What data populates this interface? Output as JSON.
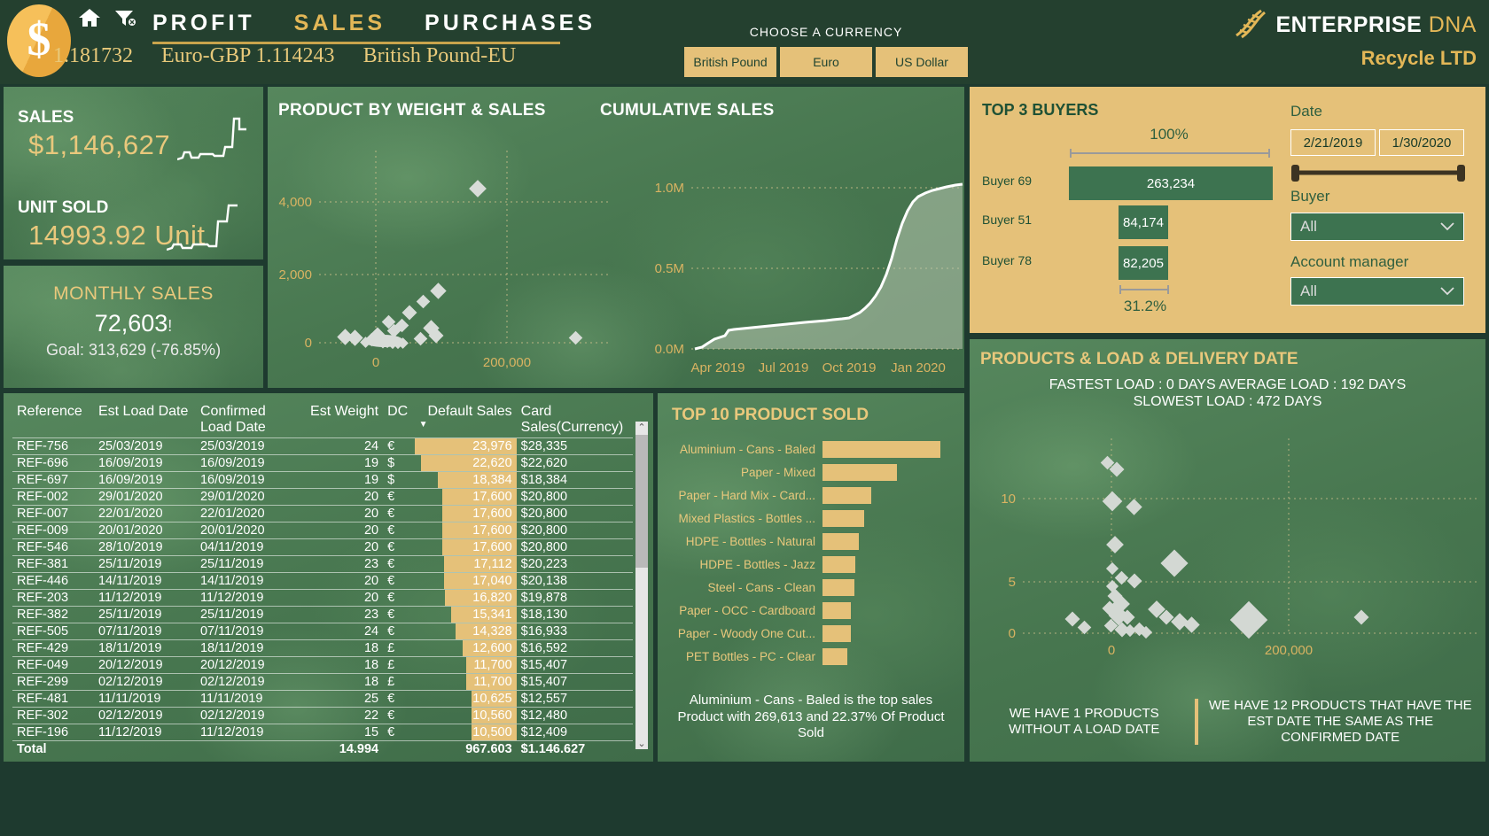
{
  "header": {
    "coin_glyph": "$",
    "nav": [
      {
        "label": "PROFIT",
        "active": false
      },
      {
        "label": "SALES",
        "active": true
      },
      {
        "label": "PURCHASES",
        "active": false
      }
    ],
    "rates": [
      "1.181732",
      "Euro-GBP 1.114243",
      "British Pound-EU"
    ],
    "currency_title": "CHOOSE A CURRENCY",
    "currency_options": [
      "British Pound",
      "Euro",
      "US Dollar"
    ],
    "logo_main": "ENTERPRISE",
    "logo_dna": "DNA",
    "logo_sub": "Recycle LTD"
  },
  "kpi": {
    "sales_label": "SALES",
    "sales_value": "$1,146,627",
    "unit_label": "UNIT SOLD",
    "unit_value": "14993.92 Unit",
    "monthly_title": "MONTHLY SALES",
    "monthly_value": "72,603",
    "monthly_flag": "!",
    "monthly_goal": "Goal: 313,629 (-76.85%)"
  },
  "charts": {
    "scatter_title": "PRODUCT BY WEIGHT & SALES",
    "cumulative_title": "CUMULATIVE SALES"
  },
  "buyers": {
    "title": "TOP 3 BUYERS",
    "top_pct": "100%",
    "bottom_pct": "31.2%",
    "rows": [
      {
        "name": "Buyer 69",
        "value": "263,234",
        "pct": 100
      },
      {
        "name": "Buyer 51",
        "value": "84,174",
        "pct": 32
      },
      {
        "name": "Buyer 78",
        "value": "82,205",
        "pct": 31.2
      }
    ],
    "date_label": "Date",
    "date_from": "2/21/2019",
    "date_to": "1/30/2020",
    "buyer_label": "Buyer",
    "buyer_value": "All",
    "am_label": "Account manager",
    "am_value": "All"
  },
  "table": {
    "columns": [
      "Reference",
      "Est Load Date",
      "Confirmed Load Date",
      "Est Weight",
      "DC",
      "Default Sales",
      "Card Sales(Currency)"
    ],
    "rows": [
      [
        "REF-756",
        "25/03/2019",
        "25/03/2019",
        "24",
        "€",
        "23,976",
        "$28,335"
      ],
      [
        "REF-696",
        "16/09/2019",
        "16/09/2019",
        "19",
        "$",
        "22,620",
        "$22,620"
      ],
      [
        "REF-697",
        "16/09/2019",
        "16/09/2019",
        "19",
        "$",
        "18,384",
        "$18,384"
      ],
      [
        "REF-002",
        "29/01/2020",
        "29/01/2020",
        "20",
        "€",
        "17,600",
        "$20,800"
      ],
      [
        "REF-007",
        "22/01/2020",
        "22/01/2020",
        "20",
        "€",
        "17,600",
        "$20,800"
      ],
      [
        "REF-009",
        "20/01/2020",
        "20/01/2020",
        "20",
        "€",
        "17,600",
        "$20,800"
      ],
      [
        "REF-546",
        "28/10/2019",
        "04/11/2019",
        "20",
        "€",
        "17,600",
        "$20,800"
      ],
      [
        "REF-381",
        "25/11/2019",
        "25/11/2019",
        "23",
        "€",
        "17,112",
        "$20,223"
      ],
      [
        "REF-446",
        "14/11/2019",
        "14/11/2019",
        "20",
        "€",
        "17,040",
        "$20,138"
      ],
      [
        "REF-203",
        "11/12/2019",
        "11/12/2019",
        "20",
        "€",
        "16,820",
        "$19,878"
      ],
      [
        "REF-382",
        "25/11/2019",
        "25/11/2019",
        "23",
        "€",
        "15,341",
        "$18,130"
      ],
      [
        "REF-505",
        "07/11/2019",
        "07/11/2019",
        "24",
        "€",
        "14,328",
        "$16,933"
      ],
      [
        "REF-429",
        "18/11/2019",
        "18/11/2019",
        "18",
        "£",
        "12,600",
        "$16,592"
      ],
      [
        "REF-049",
        "20/12/2019",
        "20/12/2019",
        "18",
        "£",
        "11,700",
        "$15,407"
      ],
      [
        "REF-299",
        "02/12/2019",
        "02/12/2019",
        "18",
        "£",
        "11,700",
        "$15,407"
      ],
      [
        "REF-481",
        "11/11/2019",
        "11/11/2019",
        "25",
        "€",
        "10,625",
        "$12,557"
      ],
      [
        "REF-302",
        "02/12/2019",
        "02/12/2019",
        "22",
        "€",
        "10,560",
        "$12,480"
      ],
      [
        "REF-196",
        "11/12/2019",
        "11/12/2019",
        "15",
        "€",
        "10,500",
        "$12,409"
      ]
    ],
    "total": [
      "Total",
      "",
      "",
      "14,994",
      "",
      "967,603",
      "$1,146,627"
    ]
  },
  "top10": {
    "title": "TOP 10 PRODUCT SOLD",
    "caption": "Aluminium - Cans - Baled is the top sales Product with 269,613 and 22.37% Of Product Sold",
    "items": [
      {
        "name": "Aluminium - Cans - Baled",
        "pct": 100
      },
      {
        "name": "Paper - Mixed",
        "pct": 63
      },
      {
        "name": "Paper - Hard Mix - Card...",
        "pct": 41
      },
      {
        "name": "Mixed Plastics - Bottles ...",
        "pct": 35
      },
      {
        "name": "HDPE - Bottles - Natural",
        "pct": 31
      },
      {
        "name": "HDPE - Bottles - Jazz",
        "pct": 28
      },
      {
        "name": "Steel - Cans - Clean",
        "pct": 27
      },
      {
        "name": "Paper - OCC - Cardboard",
        "pct": 24
      },
      {
        "name": "Paper - Woody One Cut...",
        "pct": 24
      },
      {
        "name": "PET Bottles - PC - Clear",
        "pct": 21
      }
    ]
  },
  "loaddate": {
    "title": "PRODUCTS & LOAD & DELIVERY DATE",
    "sub_line1": "FASTEST LOAD : 0 DAYS AVERAGE LOAD : 192 DAYS",
    "sub_line2": "SLOWEST LOAD : 472 DAYS",
    "foot_left": "WE HAVE 1 PRODUCTS WITHOUT A LOAD DATE",
    "foot_right": "WE HAVE 12 PRODUCTS THAT HAVE THE EST DATE THE SAME AS THE CONFIRMED DATE"
  },
  "chart_data": [
    {
      "type": "scatter",
      "title": "PRODUCT BY WEIGHT & SALES",
      "xlabel": "",
      "ylabel": "",
      "xticks": [
        0,
        200000
      ],
      "yticks": [
        0,
        2000,
        4000
      ],
      "xlim": [
        -60000,
        330000
      ],
      "ylim": [
        0,
        4800
      ],
      "grid": true,
      "points": [
        [
          150000,
          4250
        ],
        [
          300000,
          320
        ],
        [
          -40000,
          330
        ],
        [
          -32000,
          330
        ],
        [
          8000,
          700
        ],
        [
          8000,
          420
        ],
        [
          22000,
          730
        ],
        [
          30000,
          530
        ],
        [
          63000,
          1180
        ],
        [
          80000,
          1480
        ],
        [
          95000,
          1650
        ],
        [
          72000,
          480
        ],
        [
          78000,
          560
        ],
        [
          85000,
          330
        ],
        [
          88000,
          250
        ],
        [
          55000,
          230
        ],
        [
          40000,
          180
        ],
        [
          2000,
          150
        ],
        [
          6000,
          120
        ],
        [
          10000,
          100
        ],
        [
          14000,
          90
        ],
        [
          18000,
          120
        ],
        [
          22000,
          150
        ],
        [
          26000,
          110
        ],
        [
          4000,
          60
        ],
        [
          12000,
          55
        ],
        [
          20000,
          50
        ]
      ]
    },
    {
      "type": "area",
      "title": "CUMULATIVE SALES",
      "xticks": [
        "Apr 2019",
        "Jul 2019",
        "Oct 2019",
        "Jan 2020"
      ],
      "yticks": [
        "0.0M",
        "0.5M",
        "1.0M"
      ],
      "ylim": [
        0,
        1150000
      ],
      "grid": true,
      "series": [
        {
          "name": "Cumulative Sales",
          "values": [
            0,
            5000,
            18000,
            42000,
            60000,
            78000,
            82000,
            90000,
            96000,
            104000,
            112000,
            120000,
            128000,
            134000,
            140000,
            146000,
            152000,
            158000,
            164000,
            172000,
            180000,
            190000,
            205000,
            238000,
            300000,
            390000,
            500000,
            620000,
            760000,
            880000,
            960000,
            1010000,
            1060000,
            1090000,
            1110000,
            1146627
          ]
        }
      ]
    },
    {
      "type": "bar",
      "title": "TOP 3 BUYERS",
      "orientation": "horizontal",
      "categories": [
        "Buyer 69",
        "Buyer 51",
        "Buyer 78"
      ],
      "values": [
        263234,
        84174,
        82205
      ],
      "annotations": [
        "100%",
        "31.2%"
      ]
    },
    {
      "type": "bar",
      "title": "TOP 10 PRODUCT SOLD",
      "orientation": "horizontal",
      "categories": [
        "Aluminium - Cans - Baled",
        "Paper - Mixed",
        "Paper - Hard Mix - Card...",
        "Mixed Plastics - Bottles ...",
        "HDPE - Bottles - Natural",
        "HDPE - Bottles - Jazz",
        "Steel - Cans - Clean",
        "Paper - OCC - Cardboard",
        "Paper - Woody One Cut...",
        "PET Bottles - PC - Clear"
      ],
      "values": [
        269613,
        170000,
        110000,
        94000,
        84000,
        76000,
        73000,
        65000,
        65000,
        57000
      ]
    },
    {
      "type": "scatter",
      "title": "PRODUCTS & LOAD & DELIVERY DATE",
      "xticks": [
        0,
        200000
      ],
      "yticks": [
        0,
        5,
        10
      ],
      "xlim": [
        -60000,
        330000
      ],
      "ylim": [
        -1,
        15
      ],
      "grid": true,
      "points": [
        [
          -4000,
          12.6
        ],
        [
          4000,
          12.1
        ],
        [
          0,
          10.1
        ],
        [
          14000,
          9.6
        ],
        [
          2000,
          7.0
        ],
        [
          1000,
          5.4
        ],
        [
          8000,
          5.0
        ],
        [
          14000,
          4.9
        ],
        [
          70000,
          6.2
        ],
        [
          2000,
          4.0
        ],
        [
          5000,
          3.5
        ],
        [
          9000,
          3.2
        ],
        [
          38000,
          2.6
        ],
        [
          52000,
          2.1
        ],
        [
          60000,
          1.7
        ],
        [
          68000,
          1.5
        ],
        [
          110000,
          1.7
        ],
        [
          230000,
          1.9
        ],
        [
          -40000,
          1.1
        ],
        [
          -32000,
          0.6
        ],
        [
          0,
          2.3
        ],
        [
          6000,
          1.9
        ],
        [
          12000,
          1.5
        ],
        [
          3000,
          0.9
        ],
        [
          16000,
          0.7
        ],
        [
          24000,
          1.2
        ],
        [
          30000,
          0.5
        ],
        [
          44000,
          0.9
        ],
        [
          1000,
          0.3
        ],
        [
          9000,
          0.2
        ],
        [
          20000,
          0.4
        ]
      ]
    }
  ]
}
